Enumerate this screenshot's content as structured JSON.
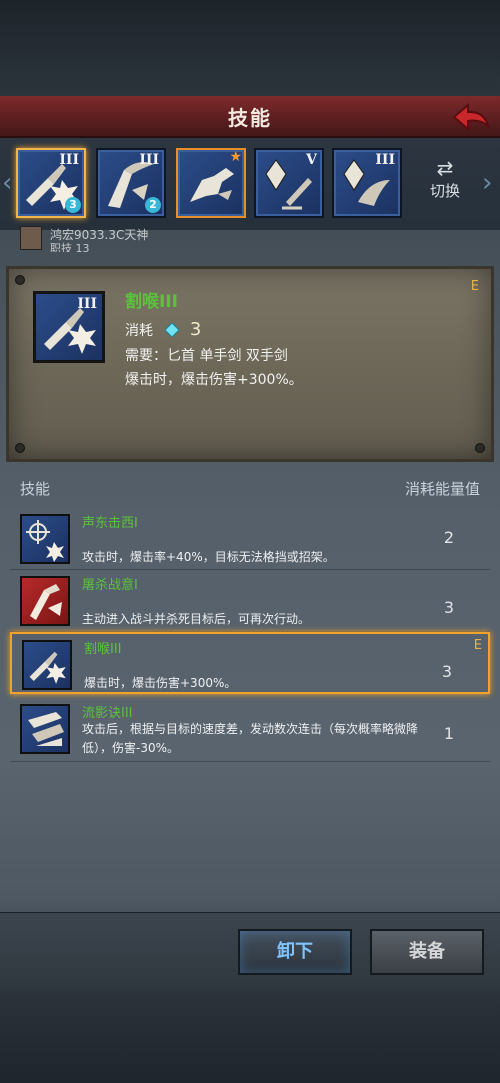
{
  "header": {
    "title": "技能"
  },
  "skill_slots": [
    {
      "level": "III",
      "badge": "3",
      "selected": true,
      "star": false
    },
    {
      "level": "III",
      "badge": "2",
      "selected": false,
      "star": false
    },
    {
      "level": "",
      "badge": "",
      "selected": false,
      "star": true
    },
    {
      "level": "V",
      "badge": "",
      "selected": false,
      "star": false
    },
    {
      "level": "III",
      "badge": "",
      "selected": false,
      "star": false
    }
  ],
  "switch": {
    "label": "切换"
  },
  "character": {
    "name": "鸿宏9033.3C天神",
    "level": "职技 13"
  },
  "detail": {
    "name": "割喉III",
    "level": "III",
    "rank": "E",
    "cost_label": "消耗",
    "cost_value": "3",
    "requirement": "需要：匕首 单手剑 双手剑",
    "description": "爆击时，爆击伤害+300%。"
  },
  "list_header": {
    "left": "技能",
    "right": "消耗能量值"
  },
  "skills": [
    {
      "name": "声东击西I",
      "desc": "攻击时，爆击率+40%，目标无法格挡或招架。",
      "cost": "2",
      "rank": ""
    },
    {
      "name": "屠杀战意I",
      "desc": "主动进入战斗并杀死目标后，可再次行动。",
      "cost": "3",
      "rank": ""
    },
    {
      "name": "割喉III",
      "desc": "爆击时，爆击伤害+300%。",
      "cost": "3",
      "rank": "E"
    },
    {
      "name": "流影诀III",
      "desc": "攻击后，根据与目标的速度差，发动数次连击（每次概率略微降低），伤害-30%。",
      "cost": "1",
      "rank": ""
    }
  ],
  "buttons": {
    "unequip": "卸下",
    "equip": "装备"
  },
  "colors": {
    "accent_gold": "#f3a32c",
    "skill_green": "#5ac23b",
    "title_red": "#5e1f21"
  }
}
